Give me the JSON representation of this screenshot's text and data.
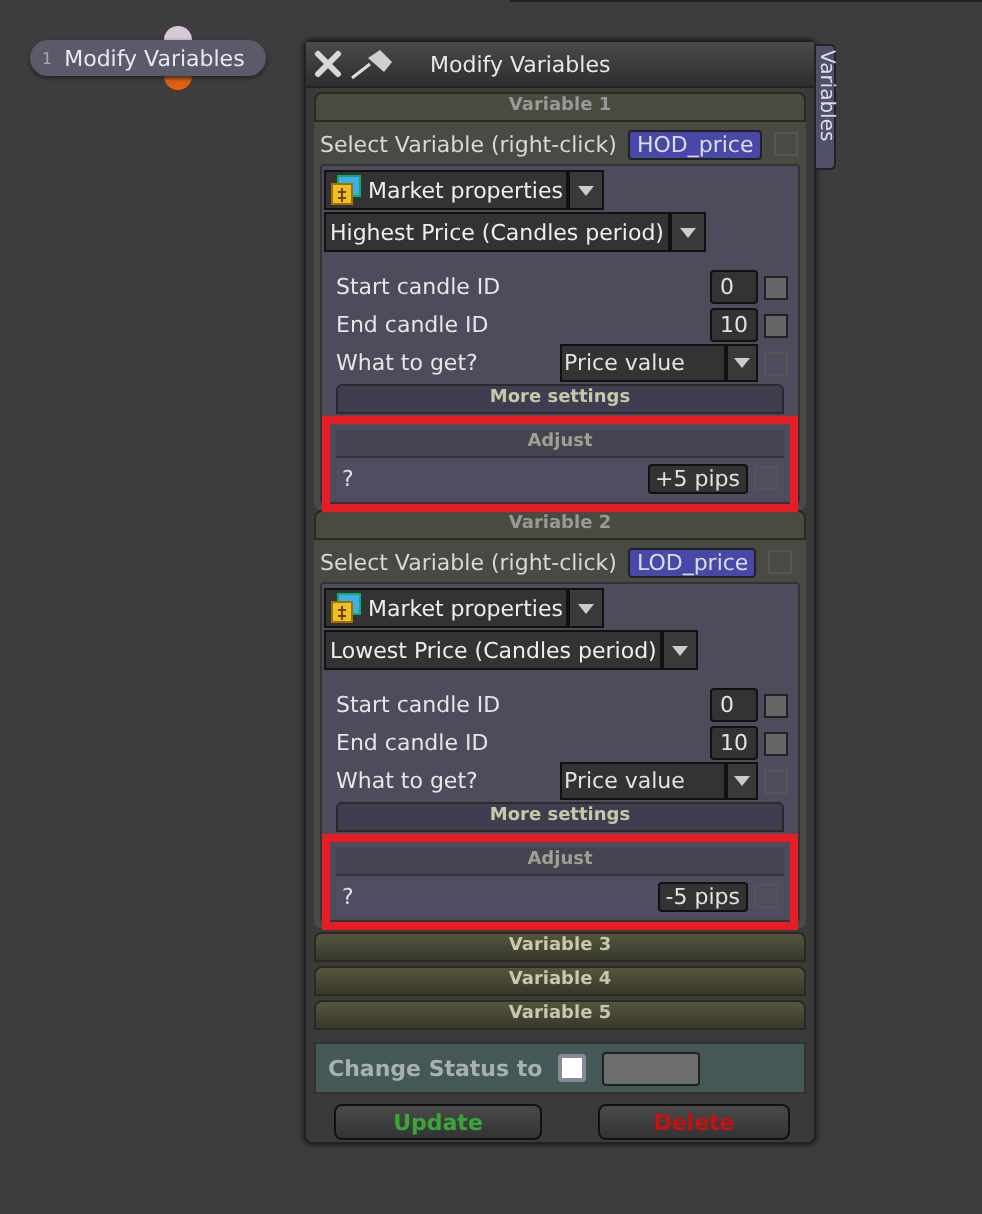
{
  "node": {
    "index": "1",
    "label": "Modify Variables"
  },
  "window": {
    "title": "Modify Variables"
  },
  "side_tab": {
    "label": "Variables"
  },
  "variables": [
    {
      "header": "Variable 1",
      "expanded": true,
      "select_label": "Select Variable (right-click)",
      "variable": "HOD_price",
      "category": "Market properties",
      "function": "Highest Price (Candles period)",
      "params": [
        {
          "kind": "input",
          "label": "Start candle ID",
          "value": "0",
          "checked": false
        },
        {
          "kind": "input",
          "label": "End candle ID",
          "value": "10",
          "checked": false
        },
        {
          "kind": "dropdown",
          "label": "What to get?",
          "value": "Price value"
        }
      ],
      "more_settings": "More settings",
      "adjust": {
        "title": "Adjust",
        "label": "?",
        "value": "+5 pips",
        "highlighted": true
      }
    },
    {
      "header": "Variable 2",
      "expanded": true,
      "select_label": "Select Variable (right-click)",
      "variable": "LOD_price",
      "category": "Market properties",
      "function": "Lowest Price (Candles period)",
      "params": [
        {
          "kind": "input",
          "label": "Start candle ID",
          "value": "0",
          "checked": false
        },
        {
          "kind": "input",
          "label": "End candle ID",
          "value": "10",
          "checked": false
        },
        {
          "kind": "dropdown",
          "label": "What to get?",
          "value": "Price value"
        }
      ],
      "more_settings": "More settings",
      "adjust": {
        "title": "Adjust",
        "label": "?",
        "value": "-5 pips",
        "highlighted": true
      }
    },
    {
      "header": "Variable 3",
      "expanded": false
    },
    {
      "header": "Variable 4",
      "expanded": false
    },
    {
      "header": "Variable 5",
      "expanded": false
    }
  ],
  "status": {
    "label": "Change Status to",
    "checked": false
  },
  "buttons": [
    {
      "label": "Update",
      "kind": "update"
    },
    {
      "label": "Delete",
      "kind": "delete"
    }
  ]
}
